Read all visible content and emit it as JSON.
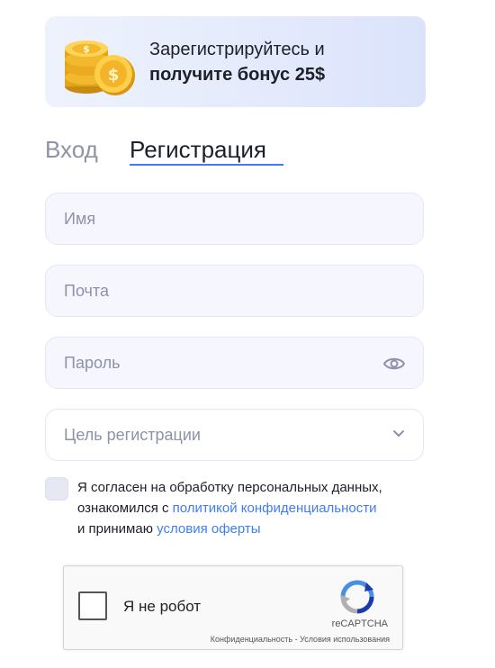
{
  "banner": {
    "line1": "Зарегистрируйтесь и",
    "line2": "получите бонус 25$",
    "icon": "coins-icon"
  },
  "tabs": {
    "login": "Вход",
    "register": "Регистрация",
    "active": "register",
    "accent_color": "#3f7ef0"
  },
  "form": {
    "name_placeholder": "Имя",
    "email_placeholder": "Почта",
    "password_placeholder": "Пароль",
    "goal_label": "Цель регистрации"
  },
  "consent": {
    "text1": "Я согласен на обработку персональных данных,",
    "text2": "ознакомился с ",
    "privacy_link": "политикой конфиденциальности",
    "text3": "и принимаю ",
    "offer_link": "условия оферты"
  },
  "recaptcha": {
    "label": "Я не робот",
    "brand": "reCAPTCHA",
    "privacy": "Конфиденциальность",
    "separator": " - ",
    "terms": "Условия использования"
  }
}
